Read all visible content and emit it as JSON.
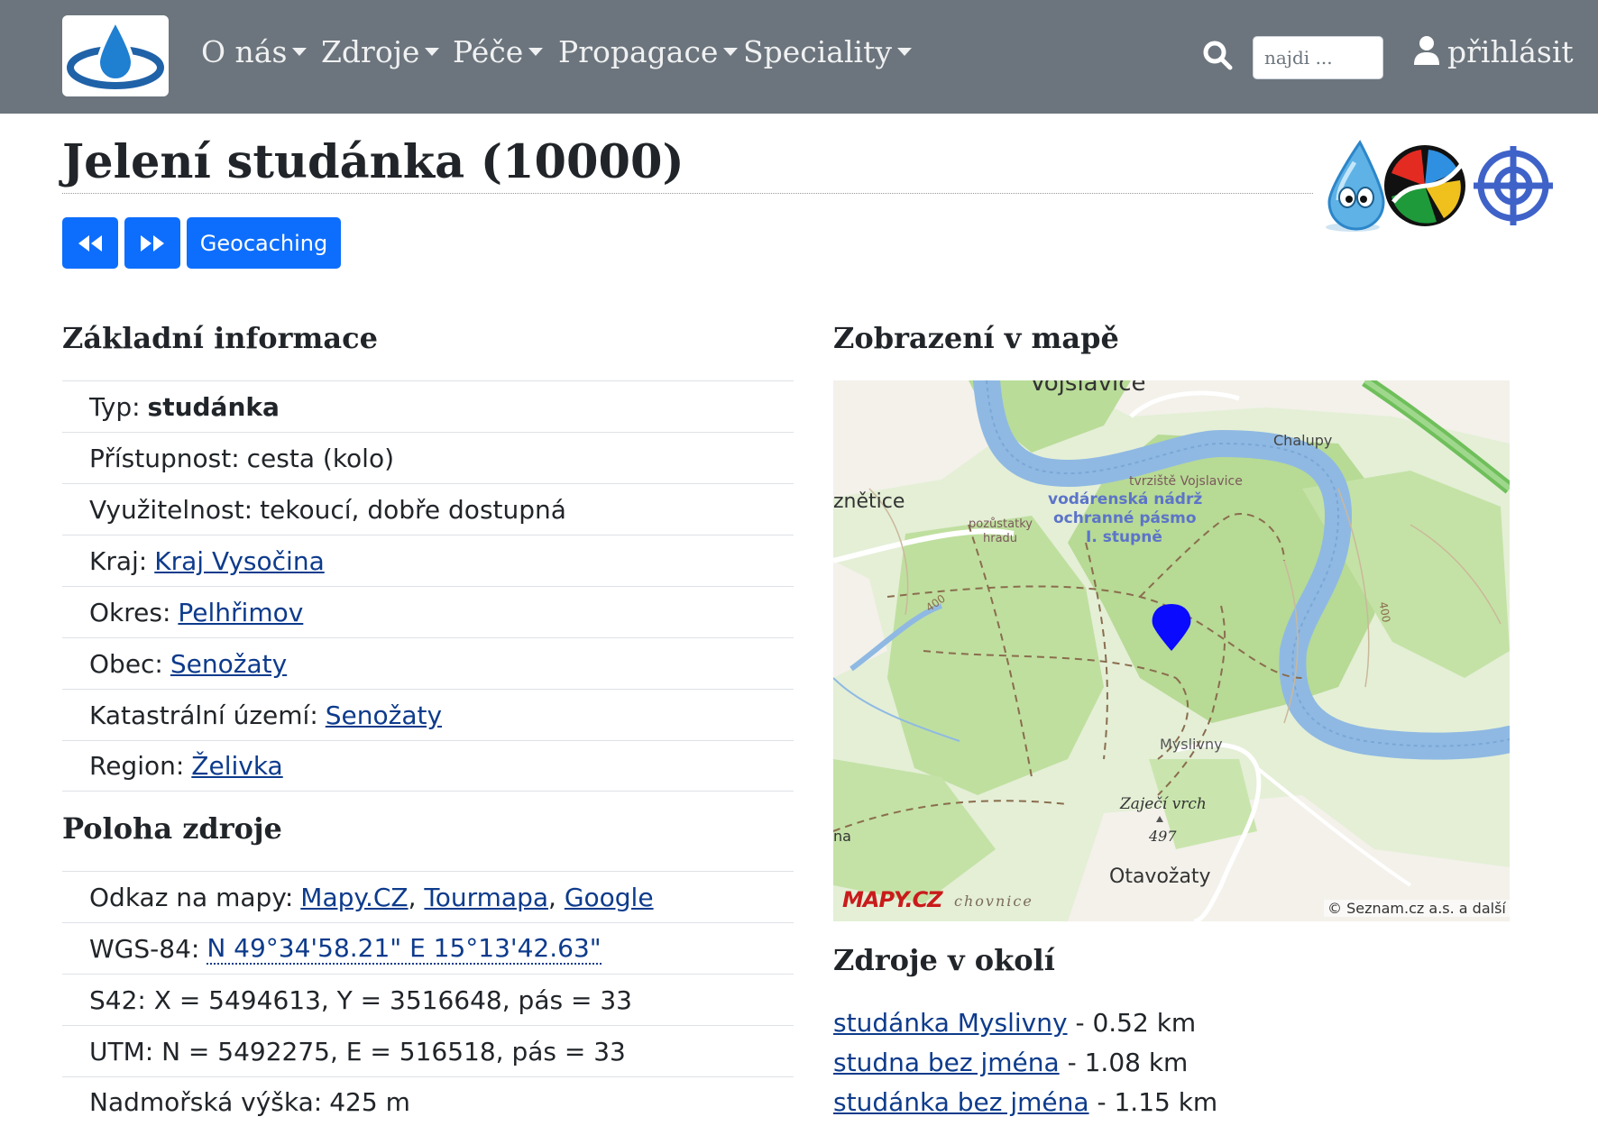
{
  "navbar": {
    "menu": [
      {
        "label": "O nás"
      },
      {
        "label": "Zdroje"
      },
      {
        "label": "Péče"
      },
      {
        "label": "Propagace"
      },
      {
        "label": "Speciality"
      }
    ],
    "search_placeholder": "najdi ...",
    "login_label": "přihlásit",
    "bg_color": "#6c757d"
  },
  "page": {
    "title": "Jelení studánka (10000)",
    "buttons": {
      "prev_icon": "rewind-icon",
      "next_icon": "fast-forward-icon",
      "geocaching_label": "Geocaching"
    },
    "badges": [
      "water-drop-mascot-icon",
      "colorful-quadrant-logo-icon",
      "crosshair-target-icon"
    ],
    "accent": "#0d6efd"
  },
  "basic_info": {
    "heading": "Základní informace",
    "typ_label": "Typ:",
    "typ_value": "studánka",
    "pristupnost_label": "Přístupnost:",
    "pristupnost_value": "cesta (kolo)",
    "vyuzitelnost_label": "Využitelnost:",
    "vyuzitelnost_value": "tekoucí, dobře dostupná",
    "kraj_label": "Kraj:",
    "kraj_value": "Kraj Vysočina",
    "okres_label": "Okres:",
    "okres_value": "Pelhřimov",
    "obec_label": "Obec:",
    "obec_value": "Senožaty",
    "katastr_label": "Katastrální území:",
    "katastr_value": "Senožaty",
    "region_label": "Region:",
    "region_value": "Želivka"
  },
  "location": {
    "heading": "Poloha zdroje",
    "maps_label": "Odkaz na mapy:",
    "maps_links": [
      "Mapy.CZ",
      "Tourmapa",
      "Google"
    ],
    "sep": ",",
    "wgs_label": "WGS-84:",
    "wgs_value": "N 49°34'58.21\" E 15°13'42.63\"",
    "s42": "S42: X = 5494613, Y = 3516648, pás = 33",
    "utm": "UTM: N = 5492275, E = 516518, pás = 33",
    "alt_label": "Nadmořská výška:",
    "alt_value": "425 m"
  },
  "map": {
    "heading": "Zobrazení v mapě",
    "labels": {
      "vojslavice": "Vojslavice",
      "chalupy": "Chalupy",
      "tvrziste": "tvrziště Vojslavice",
      "nadrz1": "vodárenská nádrž",
      "nadrz2": "ochranné pásmo",
      "nadrz3": "I. stupně",
      "znetice": "znětice",
      "pozustatky1": "pozůstatky",
      "pozustatky2": "hradu",
      "myslivny": "Myslivny",
      "zajeci": "Zaječí vrch",
      "zajeci_alt": "497",
      "otavozaty": "Otavožaty",
      "na": "na",
      "chovnice": "chovnice",
      "c400a": "400",
      "c400b": "400",
      "mapy_logo": "MAPY.CZ",
      "copyright": "© Seznam.cz a.s. a další"
    },
    "marker_icon": "map-pin-icon"
  },
  "nearby": {
    "heading": "Zdroje v okolí",
    "items": [
      {
        "name": "studánka Myslivny",
        "dist": "- 0.52 km"
      },
      {
        "name": "studna bez jména",
        "dist": "- 1.08 km"
      },
      {
        "name": "studánka bez jména",
        "dist": "- 1.15 km"
      }
    ]
  }
}
